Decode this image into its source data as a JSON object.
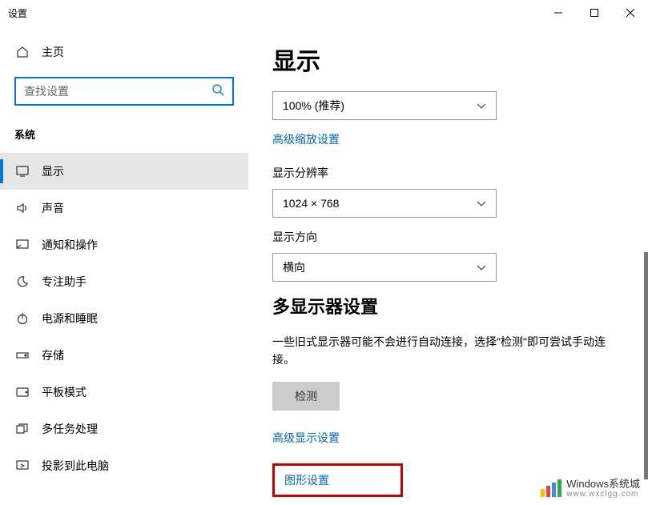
{
  "window": {
    "title": "设置"
  },
  "sidebar": {
    "home": "主页",
    "search_placeholder": "查找设置",
    "section": "系统",
    "items": [
      {
        "label": "显示"
      },
      {
        "label": "声音"
      },
      {
        "label": "通知和操作"
      },
      {
        "label": "专注助手"
      },
      {
        "label": "电源和睡眠"
      },
      {
        "label": "存储"
      },
      {
        "label": "平板模式"
      },
      {
        "label": "多任务处理"
      },
      {
        "label": "投影到此电脑"
      }
    ]
  },
  "content": {
    "heading": "显示",
    "scale_value": "100% (推荐)",
    "adv_scale_link": "高级缩放设置",
    "resolution_label": "显示分辨率",
    "resolution_value": "1024 × 768",
    "orientation_label": "显示方向",
    "orientation_value": "横向",
    "multi_heading": "多显示器设置",
    "multi_desc": "一些旧式显示器可能不会进行自动连接，选择\"检测\"即可尝试手动连接。",
    "detect_btn": "检测",
    "adv_display_link": "高级显示设置",
    "graphics_link": "图形设置"
  },
  "watermark": {
    "main": "Windows系统城",
    "sub": "www.wxclgg.com"
  }
}
